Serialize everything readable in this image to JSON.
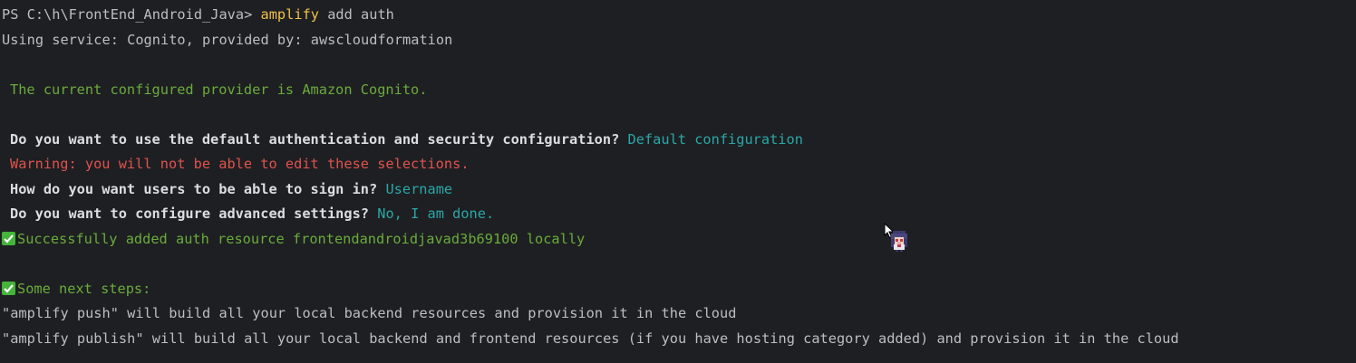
{
  "prompt": {
    "prefix": "PS C:\\h\\FrontEnd_Android_Java>",
    "command": "amplify",
    "args": "add auth"
  },
  "lines": {
    "service": "Using service: Cognito, provided by: awscloudformation",
    "provider": "The current configured provider is Amazon Cognito.",
    "q1": "Do you want to use the default authentication and security configuration?",
    "a1": "Default configuration",
    "warning": "Warning: you will not be able to edit these selections.",
    "q2": "How do you want users to be able to sign in?",
    "a2": "Username",
    "q3": "Do you want to configure advanced settings?",
    "a3": "No, I am done.",
    "success": "Successfully added auth resource frontendandroidjavad3b69100 locally",
    "next": "Some next steps:",
    "push": "\"amplify push\" will build all your local backend resources and provision it in the cloud",
    "publish": "\"amplify publish\" will build all your local backend and frontend resources (if you have hosting category added) and provision it in the cloud"
  },
  "colors": {
    "background": "#1e1f22",
    "text": "#bcbec4",
    "command": "#f0c14b",
    "success_green": "#6aab3c",
    "answer_cyan": "#2aa7a8",
    "warning_red": "#e0524f",
    "checkmark_bg": "#44b43a"
  },
  "icons": {
    "checkmark": "check-mark-icon",
    "cursor": "mouse-pointer-icon",
    "sprite": "anime-character-sprite-icon"
  }
}
